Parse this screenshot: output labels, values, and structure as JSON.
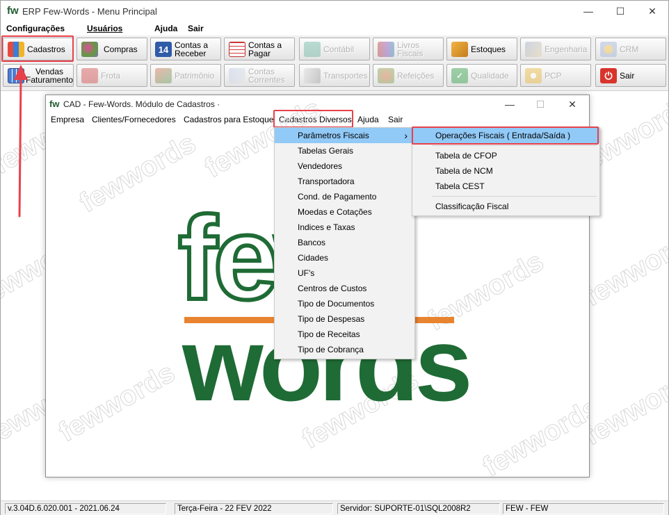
{
  "window": {
    "logo": "fw",
    "title": "ERP Few-Words - Menu Principal",
    "minimize": "—",
    "maximize": "☐",
    "close": "✕"
  },
  "menubar": {
    "items": [
      "Configurações",
      "Usuários",
      "Ajuda",
      "Sair"
    ]
  },
  "toolbar": {
    "row1": [
      {
        "label": "Cadastros",
        "icon": "cadastros-icon",
        "enabled": true
      },
      {
        "label": "Compras",
        "icon": "shopping-cart-icon",
        "enabled": true
      },
      {
        "label": "Contas a Receber",
        "icon": "calendar-14-icon",
        "enabled": true
      },
      {
        "label": "Contas a Pagar",
        "icon": "calendar-grid-icon",
        "enabled": true
      },
      {
        "label": "Contábil",
        "icon": "keyboard-icon",
        "enabled": false
      },
      {
        "label": "Livros Fiscais",
        "icon": "books-icon",
        "enabled": false
      },
      {
        "label": "Estoques",
        "icon": "boxes-icon",
        "enabled": true
      },
      {
        "label": "Engenharia",
        "icon": "drafting-icon",
        "enabled": false
      },
      {
        "label": "CRM",
        "icon": "people-icon",
        "enabled": false
      }
    ],
    "row2": [
      {
        "label": "Vendas Faturamento",
        "icon": "calculator-icon",
        "enabled": true
      },
      {
        "label": "Frota",
        "icon": "truck-icon",
        "enabled": false
      },
      {
        "label": "Patrimônio",
        "icon": "building-icon",
        "enabled": false
      },
      {
        "label": "Contas Correntes",
        "icon": "ledger-icon",
        "enabled": false
      },
      {
        "label": "Transportes",
        "icon": "transport-icon",
        "enabled": false
      },
      {
        "label": "Refeições",
        "icon": "meals-icon",
        "enabled": false
      },
      {
        "label": "Qualidade",
        "icon": "check-shield-icon",
        "enabled": false
      },
      {
        "label": "PCP",
        "icon": "gear-icon",
        "enabled": false
      },
      {
        "label": "Sair",
        "icon": "power-icon",
        "enabled": true
      }
    ]
  },
  "watermark": "fewwords",
  "cad": {
    "logo": "fw",
    "title": "CAD - Few-Words. Módulo de Cadastros ·",
    "minimize": "—",
    "maximize": "☐",
    "close": "✕",
    "menu": [
      "Empresa",
      "Clientes/Fornecedores",
      "Cadastros para Estoque",
      "Cadastros Diversos",
      "Ajuda",
      "Sair"
    ],
    "logo_few": "few",
    "logo_words": "words"
  },
  "dropdown_diversos": {
    "items": [
      "Parâmetros Fiscais",
      "Tabelas Gerais",
      "Vendedores",
      "Transportadora",
      "Cond. de Pagamento",
      "Moedas e Cotações",
      "Indices e Taxas",
      "Bancos",
      "Cidades",
      "UF's",
      "Centros de Custos",
      "Tipo de Documentos",
      "Tipo de Despesas",
      "Tipo de Receitas",
      "Tipo de Cobrança"
    ],
    "submenu_arrow": "›"
  },
  "dropdown_fiscais": {
    "items": [
      "Operações Fiscais ( Entrada/Saída )",
      "Tabela de CFOP",
      "Tabela de NCM",
      "Tabela CEST",
      "Classificação Fiscal"
    ]
  },
  "status": {
    "version": "v.3.04D.6.020.001 - 2021.06.24",
    "date": "Terça-Feira - 22 FEV 2022",
    "server": "Servidor: SUPORTE-01\\SQL2008R2",
    "company": "FEW - FEW"
  },
  "colors": {
    "highlight": "#e8414a",
    "brand_green": "#1f6b35",
    "brand_orange": "#e8832f",
    "menu_selected": "#91c9f7"
  }
}
